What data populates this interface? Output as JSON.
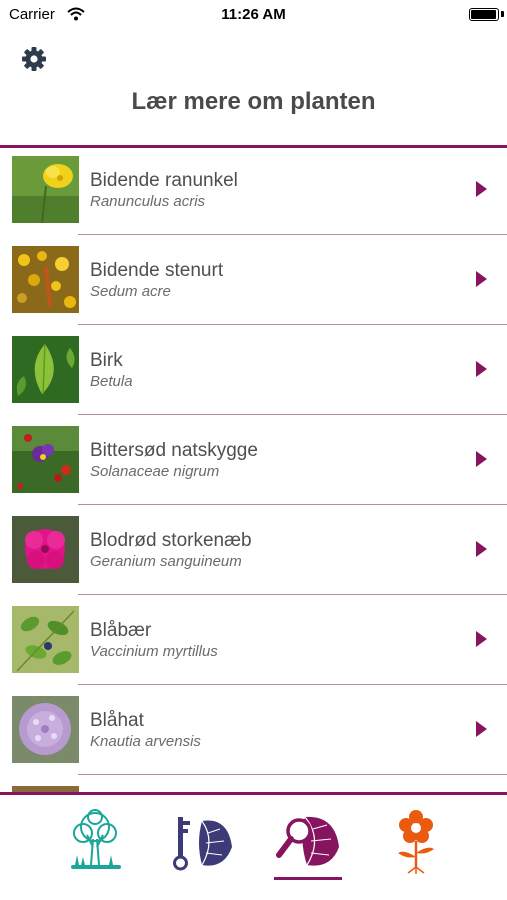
{
  "status_bar": {
    "carrier": "Carrier",
    "time": "11:26 AM",
    "battery_level": 1.0
  },
  "header": {
    "title": "Lær mere om planten",
    "settings_icon": "gear-icon"
  },
  "plants": [
    {
      "name": "Bidende ranunkel",
      "latin": "Ranunculus acris"
    },
    {
      "name": "Bidende stenurt",
      "latin": "Sedum acre"
    },
    {
      "name": "Birk",
      "latin": "Betula"
    },
    {
      "name": "Bittersød natskygge",
      "latin": "Solanaceae nigrum"
    },
    {
      "name": "Blodrød storkenæb",
      "latin": "Geranium sanguineum"
    },
    {
      "name": "Blåbær",
      "latin": "Vaccinium myrtillus"
    },
    {
      "name": "Blåhat",
      "latin": "Knautia arvensis"
    }
  ],
  "tabs": [
    {
      "icon": "tree-icon",
      "selected": false
    },
    {
      "icon": "key-leaf-icon",
      "selected": false
    },
    {
      "icon": "magnifier-leaf-icon",
      "selected": true
    },
    {
      "icon": "flower-icon",
      "selected": false
    }
  ],
  "colors": {
    "accent": "#87145f",
    "tree": "#1aa79a",
    "key": "#3d3a78",
    "flower": "#ea5a0f"
  }
}
